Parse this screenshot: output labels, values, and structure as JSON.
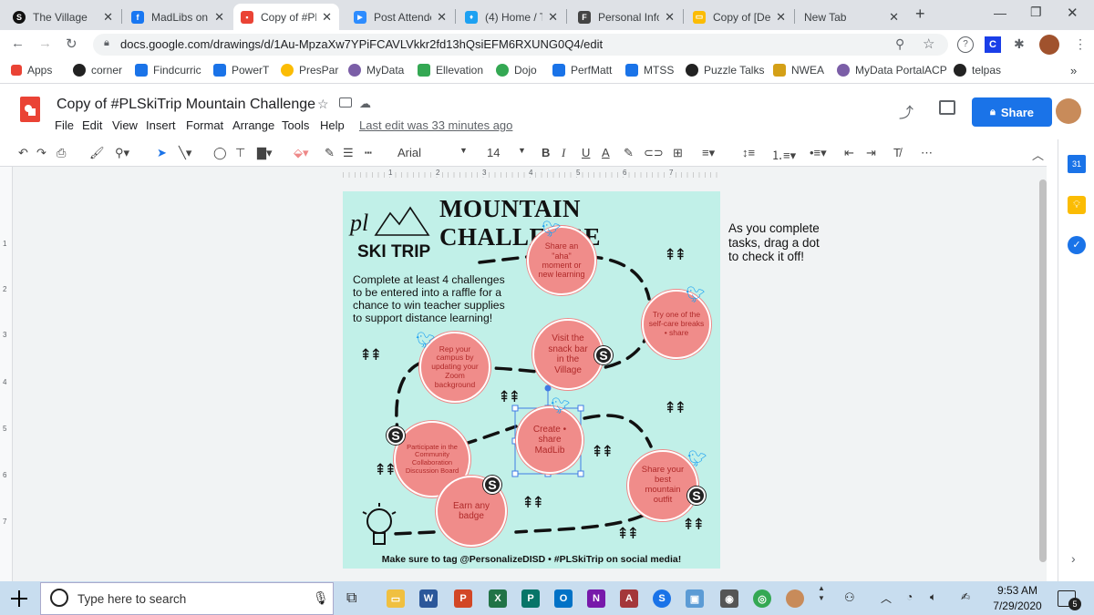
{
  "tabs": [
    {
      "title": "The Village",
      "color": "#111111",
      "glyph": "S"
    },
    {
      "title": "MadLibs on",
      "color": "#1877f2",
      "glyph": "f"
    },
    {
      "title": "Copy of #PL",
      "color": "#ea4335",
      "glyph": "▪"
    },
    {
      "title": "Post Attende",
      "color": "#2d8cff",
      "glyph": "▶"
    },
    {
      "title": "(4) Home / T",
      "color": "#1da1f2",
      "glyph": "♦"
    },
    {
      "title": "Personal Info",
      "color": "#444444",
      "glyph": "F"
    },
    {
      "title": "Copy of [De",
      "color": "#fbbc04",
      "glyph": "▭"
    },
    {
      "title": "New Tab",
      "color": "#dee1e6",
      "glyph": ""
    }
  ],
  "url": "docs.google.com/drawings/d/1Au-MpzaXw7YPiFCAVLVkkr2fd13hQsiEFM6RXUNG0Q4/edit",
  "bookmarks": [
    "Apps",
    "corner",
    "Findcurric",
    "PowerT",
    "PresPar",
    "MyData",
    "Ellevation",
    "Dojo",
    "PerfMatt",
    "MTSS",
    "Puzzle Talks",
    "NWEA",
    "MyData PortalACP",
    "telpas"
  ],
  "doc": {
    "title": "Copy of #PLSkiTrip Mountain Challenge",
    "menus": [
      "File",
      "Edit",
      "View",
      "Insert",
      "Format",
      "Arrange",
      "Tools",
      "Help"
    ],
    "last_edit": "Last edit was 33 minutes ago",
    "share": "Share",
    "font": "Arial",
    "font_size": "14",
    "ruler": [
      "1",
      "2",
      "3",
      "4",
      "5",
      "6",
      "7"
    ],
    "left_ruler": [
      "1",
      "2",
      "3",
      "4",
      "5",
      "6",
      "7"
    ]
  },
  "slide": {
    "title": "MOUNTAIN CHALLENGE",
    "logo_pl": "pl",
    "logo_ski": "SKI TRIP",
    "intro": "Complete at least 4 challenges to be entered into a raffle for a chance to win teacher supplies to support distance learning!",
    "footer": "Make sure to tag @PersonalizeDISD • #PLSkiTrip on social media!",
    "badge": "S",
    "circles": [
      {
        "id": "share-aha",
        "text": "Share an \"aha\" moment or new learning"
      },
      {
        "id": "self-care",
        "text": "Try one of the self-care breaks • share"
      },
      {
        "id": "rep-campus",
        "text": "Rep your campus by updating your Zoom background"
      },
      {
        "id": "snack-bar",
        "text": "Visit the snack bar in the Village"
      },
      {
        "id": "community",
        "text": "Participate in the Community Collaboration Discussion Board"
      },
      {
        "id": "madlib",
        "text": "Create • share MadLib"
      },
      {
        "id": "mountain-outfit",
        "text": "Share your best mountain outfit"
      },
      {
        "id": "earn-badge",
        "text": "Earn any badge"
      }
    ]
  },
  "side_note": "As you complete tasks, drag a dot to check it off!",
  "taskbar": {
    "search": "Type here to search",
    "time": "9:53 AM",
    "date": "7/29/2020",
    "notif": "5"
  }
}
